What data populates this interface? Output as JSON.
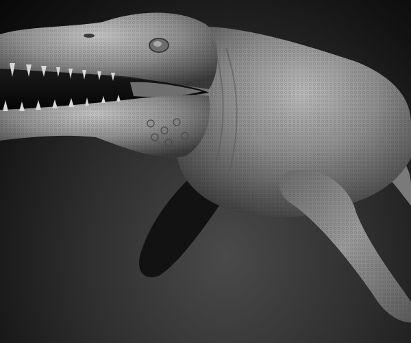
{
  "scene": {
    "subject": "sculpted-marine-reptile",
    "material": "gray-clay",
    "background_color": "#2a2a2a",
    "model_color": "#8a8a8a"
  }
}
